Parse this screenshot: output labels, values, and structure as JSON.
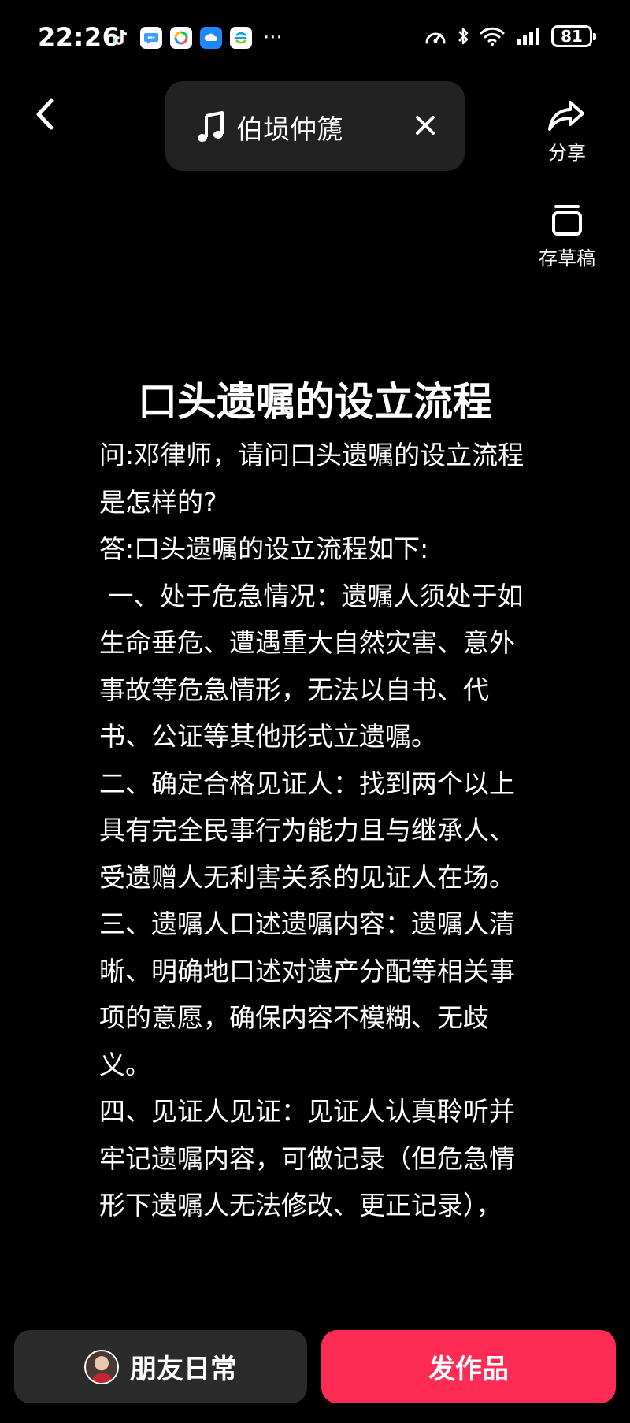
{
  "status_bar": {
    "time": "22:26",
    "notifications": [
      {
        "name": "tiktok-icon",
        "color": "#000000"
      },
      {
        "name": "chat-bubble-icon",
        "color": "#ffffff"
      },
      {
        "name": "ring-app-icon",
        "color": "#ffffff"
      },
      {
        "name": "cloud-app-icon",
        "color": "#1e88ff"
      },
      {
        "name": "china-mobile-icon",
        "color": "#ffffff"
      }
    ],
    "more": "···",
    "battery": "81"
  },
  "music": {
    "title": "伯埙仲篪"
  },
  "actions": {
    "share_label": "分享",
    "draft_label": "存草稿"
  },
  "document": {
    "title": "口头遗嘱的设立流程",
    "paragraphs": [
      "问:邓律师，请问口头遗嘱的设立流程是怎样的?",
      "答:口头遗嘱的设立流程如下:",
      " 一、处于危急情况：遗嘱人须处于如生命垂危、遭遇重大自然灾害、意外事故等危急情形，无法以自书、代书、公证等其他形式立遗嘱。",
      "二、确定合格见证人：找到两个以上具有完全民事行为能力且与继承人、受遗赠人无利害关系的见证人在场。",
      "三、遗嘱人口述遗嘱内容：遗嘱人清晰、明确地口述对遗产分配等相关事项的意愿，确保内容不模糊、无歧义。",
      "四、见证人见证：见证人认真聆听并牢记遗嘱内容，可做记录（但危急情形下遗嘱人无法修改、更正记录），"
    ]
  },
  "bottom": {
    "friends_label": "朋友日常",
    "publish_label": "发作品",
    "publish_color": "#fe2c55"
  }
}
